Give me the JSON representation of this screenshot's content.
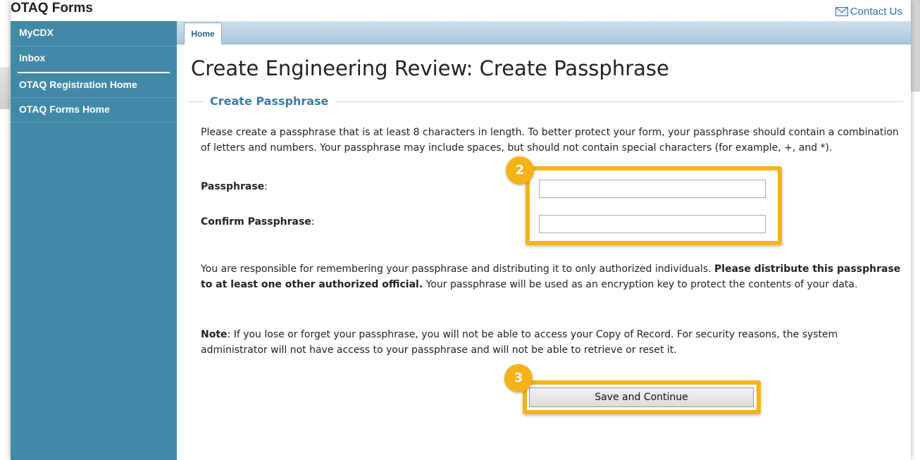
{
  "header": {
    "app_title": "OTAQ Forms",
    "contact_label": "Contact Us"
  },
  "sidebar": {
    "items": [
      {
        "label": "MyCDX"
      },
      {
        "label": "Inbox"
      },
      {
        "label": "OTAQ Registration Home"
      },
      {
        "label": "OTAQ Forms Home"
      }
    ]
  },
  "tabs": [
    {
      "label": "Home",
      "active": true
    }
  ],
  "page": {
    "title": "Create Engineering Review: Create Passphrase",
    "section_legend": "Create Passphrase",
    "intro": "Please create a passphrase that is at least 8 characters in length. To better protect your form, your passphrase should contain a combination of letters and numbers. Your passphrase may include spaces, but should not contain special characters (for example, +, and *).",
    "passphrase_label": "Passphrase",
    "confirm_label": "Confirm Passphrase",
    "label_suffix": ":",
    "passphrase_value": "",
    "confirm_value": "",
    "responsibility_pre": "You are responsible for remembering your passphrase and distributing it to only authorized individuals. ",
    "responsibility_bold": "Please distribute this passphrase to at least one other authorized official.",
    "responsibility_post": " Your passphrase will be used as an encryption key to protect the contents of your data.",
    "note_label": "Note",
    "note_text": ": If you lose or forget your passphrase, you will not be able to access your Copy of Record. For security reasons, the system administrator will not have access to your passphrase and will not be able to retrieve or reset it.",
    "save_button": "Save and Continue"
  },
  "annotations": {
    "step_fields": "2",
    "step_save": "3",
    "highlight_color": "#f7b316"
  },
  "colors": {
    "sidebar_bg": "#4289a8",
    "link": "#2a73b8",
    "legend": "#3a7ca5"
  },
  "icons": {
    "contact": "envelope-icon"
  }
}
